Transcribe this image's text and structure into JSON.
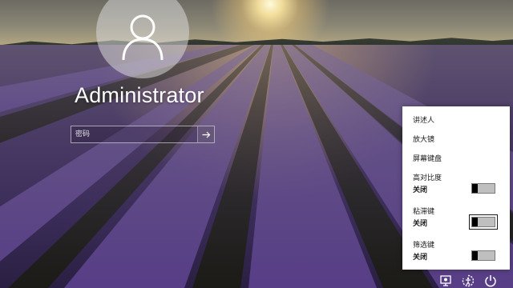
{
  "user": {
    "name": "Administrator",
    "avatar_icon": "user-silhouette-icon"
  },
  "password": {
    "placeholder": "密码",
    "value": "",
    "submit_icon": "arrow-right-icon"
  },
  "ease_of_access": {
    "items": [
      {
        "label": "讲述人"
      },
      {
        "label": "放大镜"
      },
      {
        "label": "屏幕键盘"
      }
    ],
    "toggles": [
      {
        "label": "高对比度",
        "state": "关闭",
        "on": false,
        "focused": false
      },
      {
        "label": "粘滞键",
        "state": "关闭",
        "on": false,
        "focused": true
      },
      {
        "label": "筛选键",
        "state": "关闭",
        "on": false,
        "focused": false
      }
    ]
  },
  "corner_icons": [
    "network-icon",
    "ease-of-access-icon",
    "power-icon"
  ],
  "colors": {
    "flyout_bg": "#ffffff",
    "text_dark": "#1a1a1a",
    "toggle_knob": "#000000",
    "toggle_track": "#bfbfbf"
  }
}
